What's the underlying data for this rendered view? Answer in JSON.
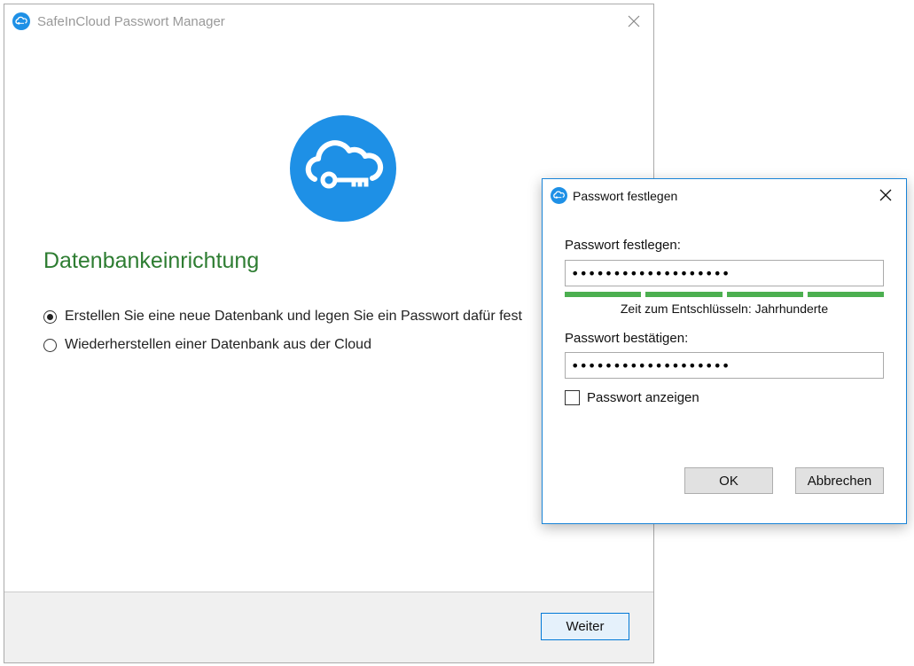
{
  "main_window": {
    "title": "SafeInCloud Passwort Manager",
    "heading": "Datenbankeinrichtung",
    "options": [
      {
        "label": "Erstellen Sie eine neue Datenbank und legen Sie ein Passwort dafür fest",
        "selected": true
      },
      {
        "label": "Wiederherstellen einer Datenbank aus der Cloud",
        "selected": false
      }
    ],
    "next_button": "Weiter",
    "icons": {
      "app": "cloud-key-icon",
      "close": "close-icon",
      "logo": "cloud-key-logo"
    },
    "colors": {
      "brand": "#1e90e6",
      "heading": "#2e7d32"
    }
  },
  "dialog": {
    "title": "Passwort festlegen",
    "password_label": "Passwort festlegen:",
    "password_value": "•••••••••••••••••••",
    "strength_text": "Zeit zum Entschlüsseln: Jahrhunderte",
    "strength_level": 1.0,
    "strength_color": "#4caf50",
    "confirm_label": "Passwort bestätigen:",
    "confirm_value": "•••••••••••••••••••",
    "show_password_label": "Passwort anzeigen",
    "show_password_checked": false,
    "ok_button": "OK",
    "cancel_button": "Abbrechen",
    "icons": {
      "app": "cloud-key-icon",
      "close": "close-icon"
    }
  }
}
